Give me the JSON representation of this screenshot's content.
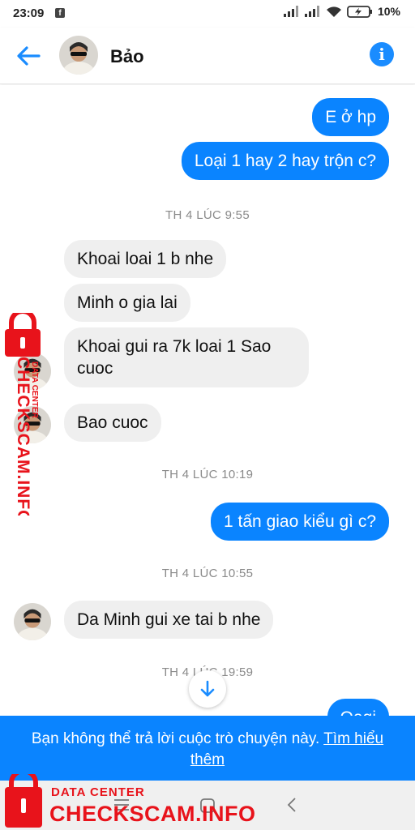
{
  "status_bar": {
    "time": "23:09",
    "notification_icon": "facebook-icon",
    "battery_percent": "10%",
    "icons": [
      "signal-icon",
      "signal-icon",
      "wifi-icon",
      "battery-charging-icon"
    ]
  },
  "header": {
    "contact_name": "Bảo",
    "back_icon": "arrow-left-icon",
    "info_icon": "info-icon",
    "accent": "#1a8cff"
  },
  "messages": [
    {
      "dir": "out",
      "text": "E ở hp"
    },
    {
      "dir": "out",
      "text": "Loại 1 hay 2 hay trộn c?"
    },
    {
      "dir": "time",
      "text": "TH 4 LÚC 9:55"
    },
    {
      "dir": "in",
      "text": "Khoai loai 1 b nhe"
    },
    {
      "dir": "in",
      "text": "Minh o gia lai"
    },
    {
      "dir": "in",
      "text": "Khoai gui ra 7k loai 1 Sao\ncuoc"
    },
    {
      "dir": "in",
      "text": "Bao cuoc"
    },
    {
      "dir": "time",
      "text": "TH 4 LÚC 10:19"
    },
    {
      "dir": "out",
      "text": "1 tấn giao kiểu gì c?"
    },
    {
      "dir": "time",
      "text": "TH 4 LÚC 10:55"
    },
    {
      "dir": "in",
      "text": "Da Minh gui xe tai b nhe"
    },
    {
      "dir": "time",
      "text": "TH 4 LÚC 19:59"
    },
    {
      "dir": "out",
      "text": "Oagi"
    }
  ],
  "banner": {
    "text": "Bạn không thể trả lời cuộc trò chuyện này.",
    "link": "Tìm hiểu thêm"
  },
  "watermark": {
    "line1": "DATA CENTER",
    "line2": "CHECKSCAM.INFO",
    "color": "#e8131b"
  },
  "colors": {
    "outgoing_bubble": "#0a84ff",
    "incoming_bubble": "#efefef",
    "banner": "#0a84ff"
  }
}
